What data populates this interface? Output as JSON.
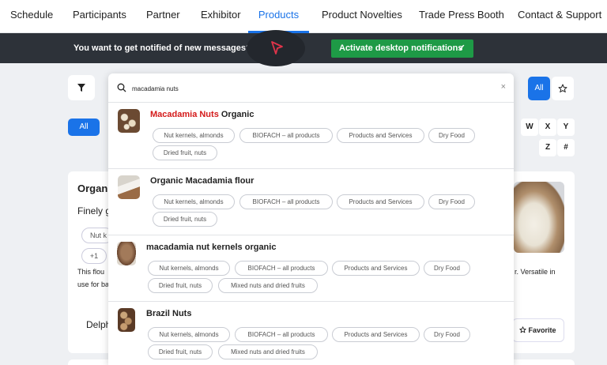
{
  "nav": {
    "items": [
      "Schedule",
      "Participants",
      "Partner",
      "Exhibitor",
      "Products",
      "Product Novelties",
      "Trade Press Booth",
      "Contact & Support"
    ],
    "active": "Products"
  },
  "notification": {
    "text": "You want to get notified of new messages?",
    "button_label": "Activate desktop notifications",
    "button_check": "✓"
  },
  "filters": {
    "all_label": "All",
    "letters": [
      "W",
      "X",
      "Y",
      "Z",
      "#"
    ]
  },
  "background_card": {
    "title_partial": "Organi",
    "line_partial": "Finely g",
    "tag_partial": "Nut k",
    "more_tags": "+1",
    "desc_line1": "This flou",
    "desc_line2": "use for ba",
    "desc_right": "r. Versatile in",
    "exhibitor_partial": "Delph",
    "favorite_label": "Favorite"
  },
  "search": {
    "value": "macadamia nuts",
    "clear_icon": "×"
  },
  "results": [
    {
      "title_highlight": "Macadamia Nuts",
      "title_rest": " Organic",
      "tags": [
        "Nut kernels, almonds",
        "BIOFACH – all products",
        "Products and Services",
        "Dry Food",
        "Dried fruit, nuts"
      ]
    },
    {
      "title_highlight": "",
      "title_rest": "Organic Macadamia flour",
      "tags": [
        "Nut kernels, almonds",
        "BIOFACH – all products",
        "Products and Services",
        "Dry Food",
        "Dried fruit, nuts"
      ]
    },
    {
      "title_highlight": "",
      "title_rest": "macadamia nut kernels organic",
      "tags": [
        "Nut kernels, almonds",
        "BIOFACH – all products",
        "Products and Services",
        "Dry Food",
        "Dried fruit, nuts",
        "Mixed nuts and dried fruits"
      ]
    },
    {
      "title_highlight": "",
      "title_rest": "Brazil Nuts",
      "tags": [
        "Nut kernels, almonds",
        "BIOFACH – all products",
        "Products and Services",
        "Dry Food",
        "Dried fruit, nuts",
        "Mixed nuts and dried fruits"
      ]
    }
  ],
  "colors": {
    "accent": "#1a73e8",
    "highlight": "#d41a1a",
    "notif_bg": "#2d3239",
    "notif_button": "#1e9a46"
  }
}
